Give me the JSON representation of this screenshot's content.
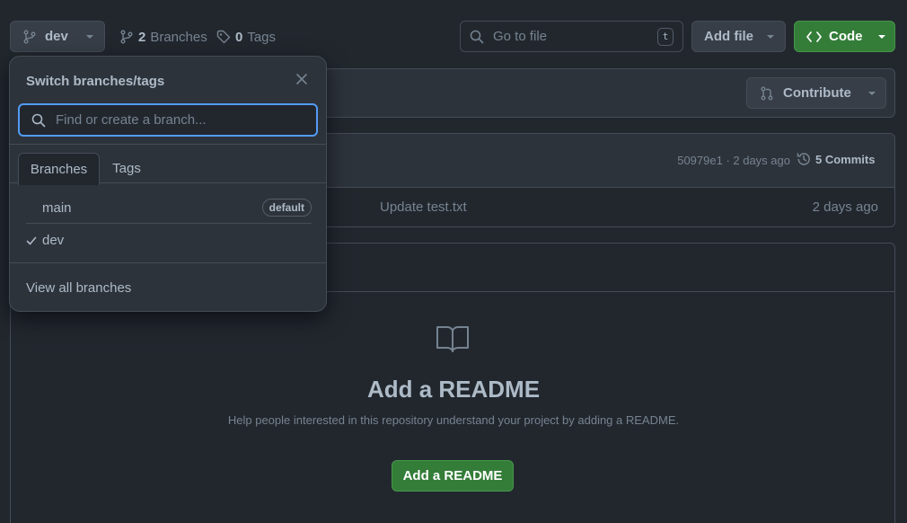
{
  "top_bar": {
    "branch_selector": "dev",
    "branches_count": "2",
    "branches_label": "Branches",
    "tags_count": "0",
    "tags_label": "Tags",
    "goto_placeholder": "Go to file",
    "goto_shortcut": "t",
    "add_file_label": "Add file",
    "code_label": "Code"
  },
  "contribute_label": "Contribute",
  "latest_commit": {
    "hash_and_time": "50979e1 · 2 days ago",
    "commits_label": "5 Commits"
  },
  "file_row": {
    "message": "Update test.txt",
    "time": "2 days ago"
  },
  "readme": {
    "title": "Add a README",
    "subtitle": "Help people interested in this repository understand your project by adding a README.",
    "button": "Add a README"
  },
  "dropdown": {
    "title": "Switch branches/tags",
    "search_placeholder": "Find or create a branch...",
    "tabs": [
      "Branches",
      "Tags"
    ],
    "branches": [
      {
        "name": "main",
        "badge": "default",
        "selected": false
      },
      {
        "name": "dev",
        "badge": "",
        "selected": true
      }
    ],
    "footer": "View all branches"
  },
  "colors": {
    "background": "#22272e",
    "panel": "#2d333b",
    "border": "#444c56",
    "accent_green": "#347d39",
    "focus_blue": "#539bf5"
  }
}
